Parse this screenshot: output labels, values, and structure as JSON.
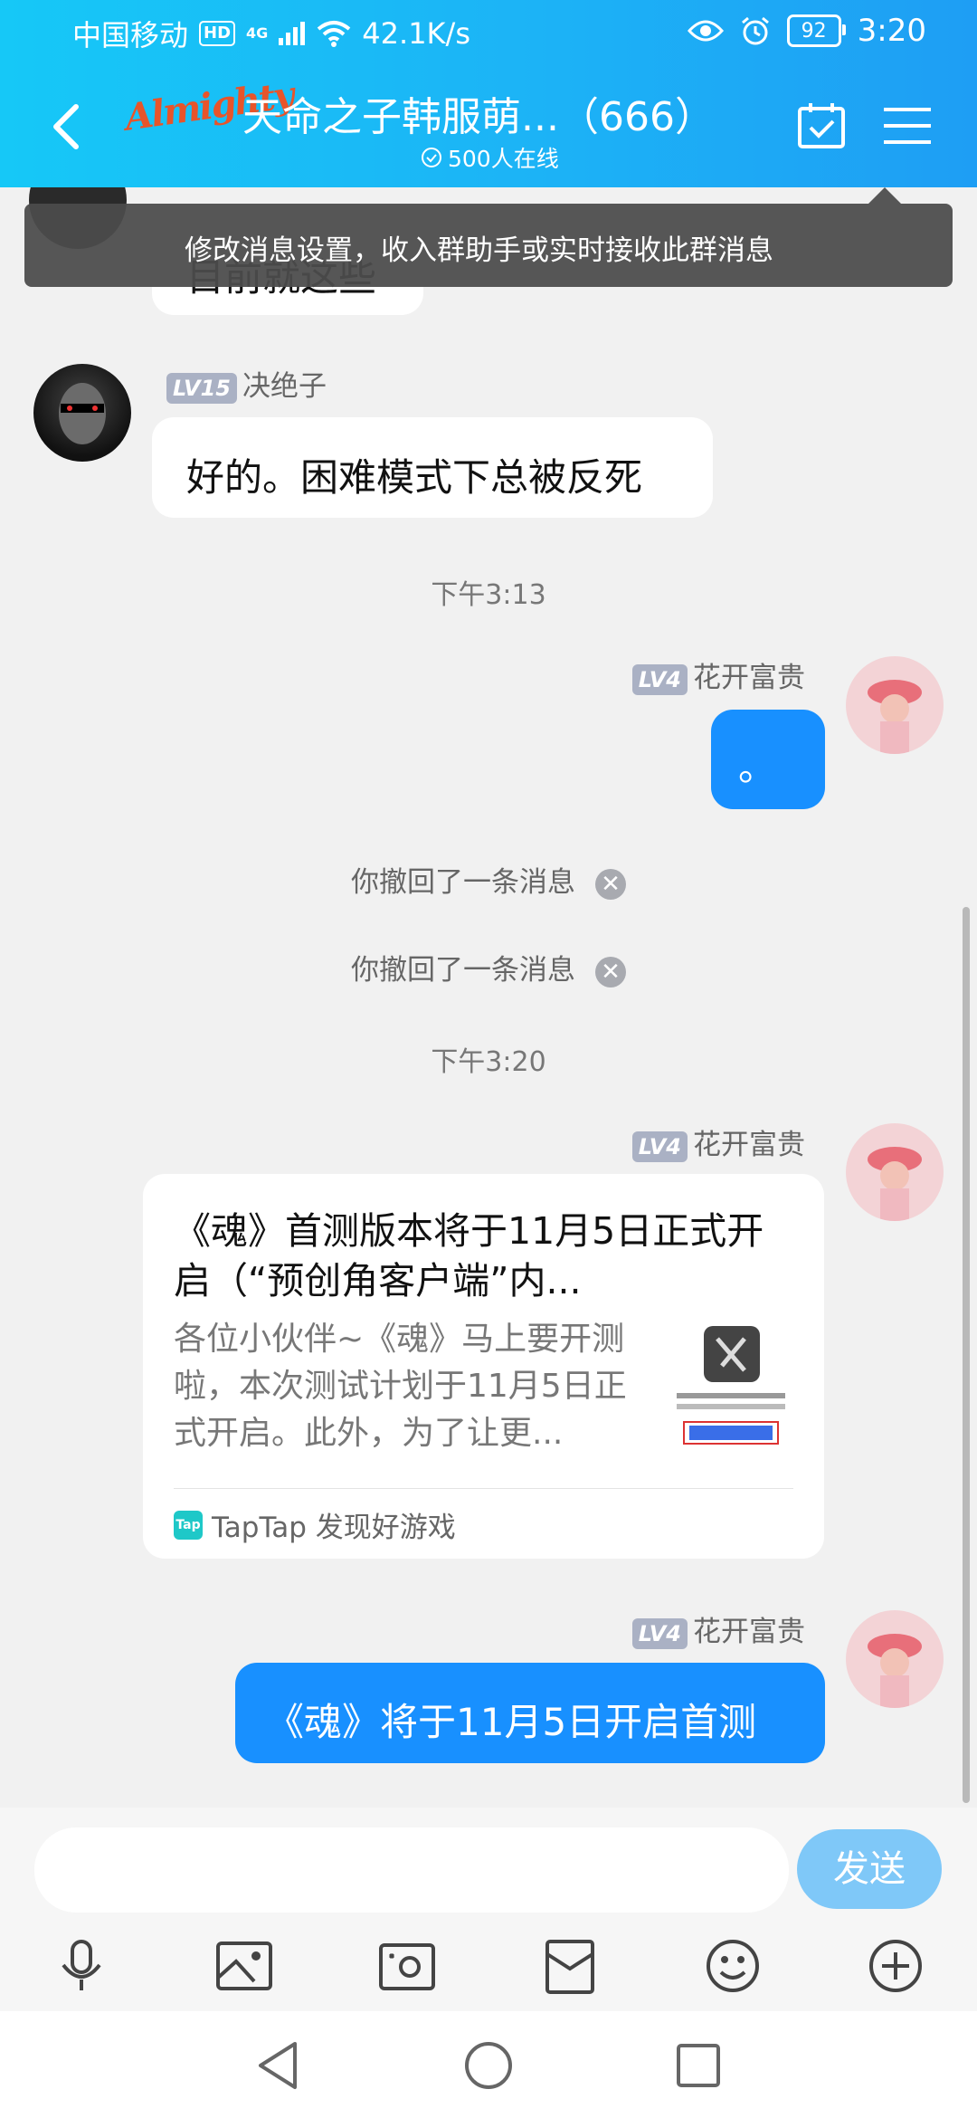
{
  "status_bar": {
    "carrier": "中国移动",
    "hd": "HD",
    "signal": "4G",
    "speed": "42.1K/s",
    "battery": "92",
    "time": "3:20"
  },
  "header": {
    "logo_text": "Almighty",
    "title": "天命之子韩服萌...（666）",
    "online": "500人在线"
  },
  "tooltip": {
    "text": "修改消息设置，收入群助手或实时接收此群消息"
  },
  "messages": {
    "partial_text": "目前就这些",
    "msg1": {
      "level": "LV15",
      "nick": "决绝子",
      "text": "好的。困难模式下总被反死"
    },
    "time1": "下午3:13",
    "msg2": {
      "level": "LV4",
      "nick": "花开富贵",
      "text": "。"
    },
    "recall1": "你撤回了一条消息",
    "recall2": "你撤回了一条消息",
    "time2": "下午3:20",
    "msg3": {
      "level": "LV4",
      "nick": "花开富贵",
      "card_title": "《魂》首测版本将于11月5日正式开启（“预创角客户端”内...",
      "card_desc": "各位小伙伴~《魂》马上要开测啦，本次测试计划于11月5日正式开启。此外，为了让更...",
      "card_source": "TapTap 发现好游戏",
      "tap_logo": "Tap"
    },
    "msg4": {
      "level": "LV4",
      "nick": "花开富贵",
      "text": "《魂》将于11月5日开启首测"
    }
  },
  "input": {
    "placeholder": "",
    "send_label": "发送"
  },
  "colors": {
    "header_start": "#16c8f7",
    "header_end": "#1e9ef4",
    "bubble_out": "#1890ff",
    "send_button": "#7fc8f8"
  }
}
